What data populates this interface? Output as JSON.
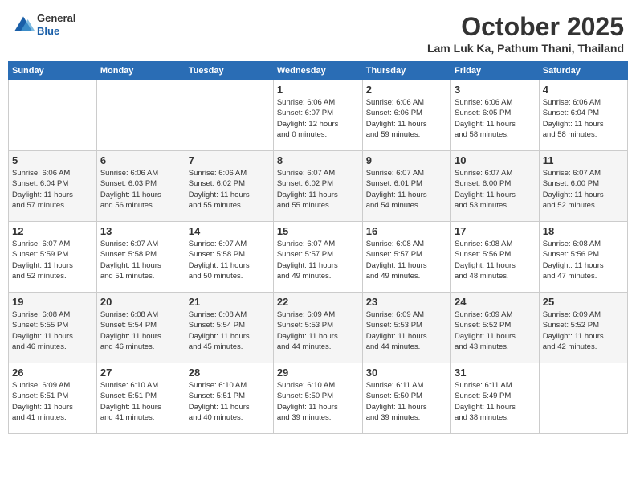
{
  "header": {
    "logo_general": "General",
    "logo_blue": "Blue",
    "month": "October 2025",
    "location": "Lam Luk Ka, Pathum Thani, Thailand"
  },
  "days_of_week": [
    "Sunday",
    "Monday",
    "Tuesday",
    "Wednesday",
    "Thursday",
    "Friday",
    "Saturday"
  ],
  "weeks": [
    [
      {
        "day": "",
        "info": ""
      },
      {
        "day": "",
        "info": ""
      },
      {
        "day": "",
        "info": ""
      },
      {
        "day": "1",
        "info": "Sunrise: 6:06 AM\nSunset: 6:07 PM\nDaylight: 12 hours\nand 0 minutes."
      },
      {
        "day": "2",
        "info": "Sunrise: 6:06 AM\nSunset: 6:06 PM\nDaylight: 11 hours\nand 59 minutes."
      },
      {
        "day": "3",
        "info": "Sunrise: 6:06 AM\nSunset: 6:05 PM\nDaylight: 11 hours\nand 58 minutes."
      },
      {
        "day": "4",
        "info": "Sunrise: 6:06 AM\nSunset: 6:04 PM\nDaylight: 11 hours\nand 58 minutes."
      }
    ],
    [
      {
        "day": "5",
        "info": "Sunrise: 6:06 AM\nSunset: 6:04 PM\nDaylight: 11 hours\nand 57 minutes."
      },
      {
        "day": "6",
        "info": "Sunrise: 6:06 AM\nSunset: 6:03 PM\nDaylight: 11 hours\nand 56 minutes."
      },
      {
        "day": "7",
        "info": "Sunrise: 6:06 AM\nSunset: 6:02 PM\nDaylight: 11 hours\nand 55 minutes."
      },
      {
        "day": "8",
        "info": "Sunrise: 6:07 AM\nSunset: 6:02 PM\nDaylight: 11 hours\nand 55 minutes."
      },
      {
        "day": "9",
        "info": "Sunrise: 6:07 AM\nSunset: 6:01 PM\nDaylight: 11 hours\nand 54 minutes."
      },
      {
        "day": "10",
        "info": "Sunrise: 6:07 AM\nSunset: 6:00 PM\nDaylight: 11 hours\nand 53 minutes."
      },
      {
        "day": "11",
        "info": "Sunrise: 6:07 AM\nSunset: 6:00 PM\nDaylight: 11 hours\nand 52 minutes."
      }
    ],
    [
      {
        "day": "12",
        "info": "Sunrise: 6:07 AM\nSunset: 5:59 PM\nDaylight: 11 hours\nand 52 minutes."
      },
      {
        "day": "13",
        "info": "Sunrise: 6:07 AM\nSunset: 5:58 PM\nDaylight: 11 hours\nand 51 minutes."
      },
      {
        "day": "14",
        "info": "Sunrise: 6:07 AM\nSunset: 5:58 PM\nDaylight: 11 hours\nand 50 minutes."
      },
      {
        "day": "15",
        "info": "Sunrise: 6:07 AM\nSunset: 5:57 PM\nDaylight: 11 hours\nand 49 minutes."
      },
      {
        "day": "16",
        "info": "Sunrise: 6:08 AM\nSunset: 5:57 PM\nDaylight: 11 hours\nand 49 minutes."
      },
      {
        "day": "17",
        "info": "Sunrise: 6:08 AM\nSunset: 5:56 PM\nDaylight: 11 hours\nand 48 minutes."
      },
      {
        "day": "18",
        "info": "Sunrise: 6:08 AM\nSunset: 5:56 PM\nDaylight: 11 hours\nand 47 minutes."
      }
    ],
    [
      {
        "day": "19",
        "info": "Sunrise: 6:08 AM\nSunset: 5:55 PM\nDaylight: 11 hours\nand 46 minutes."
      },
      {
        "day": "20",
        "info": "Sunrise: 6:08 AM\nSunset: 5:54 PM\nDaylight: 11 hours\nand 46 minutes."
      },
      {
        "day": "21",
        "info": "Sunrise: 6:08 AM\nSunset: 5:54 PM\nDaylight: 11 hours\nand 45 minutes."
      },
      {
        "day": "22",
        "info": "Sunrise: 6:09 AM\nSunset: 5:53 PM\nDaylight: 11 hours\nand 44 minutes."
      },
      {
        "day": "23",
        "info": "Sunrise: 6:09 AM\nSunset: 5:53 PM\nDaylight: 11 hours\nand 44 minutes."
      },
      {
        "day": "24",
        "info": "Sunrise: 6:09 AM\nSunset: 5:52 PM\nDaylight: 11 hours\nand 43 minutes."
      },
      {
        "day": "25",
        "info": "Sunrise: 6:09 AM\nSunset: 5:52 PM\nDaylight: 11 hours\nand 42 minutes."
      }
    ],
    [
      {
        "day": "26",
        "info": "Sunrise: 6:09 AM\nSunset: 5:51 PM\nDaylight: 11 hours\nand 41 minutes."
      },
      {
        "day": "27",
        "info": "Sunrise: 6:10 AM\nSunset: 5:51 PM\nDaylight: 11 hours\nand 41 minutes."
      },
      {
        "day": "28",
        "info": "Sunrise: 6:10 AM\nSunset: 5:51 PM\nDaylight: 11 hours\nand 40 minutes."
      },
      {
        "day": "29",
        "info": "Sunrise: 6:10 AM\nSunset: 5:50 PM\nDaylight: 11 hours\nand 39 minutes."
      },
      {
        "day": "30",
        "info": "Sunrise: 6:11 AM\nSunset: 5:50 PM\nDaylight: 11 hours\nand 39 minutes."
      },
      {
        "day": "31",
        "info": "Sunrise: 6:11 AM\nSunset: 5:49 PM\nDaylight: 11 hours\nand 38 minutes."
      },
      {
        "day": "",
        "info": ""
      }
    ]
  ]
}
